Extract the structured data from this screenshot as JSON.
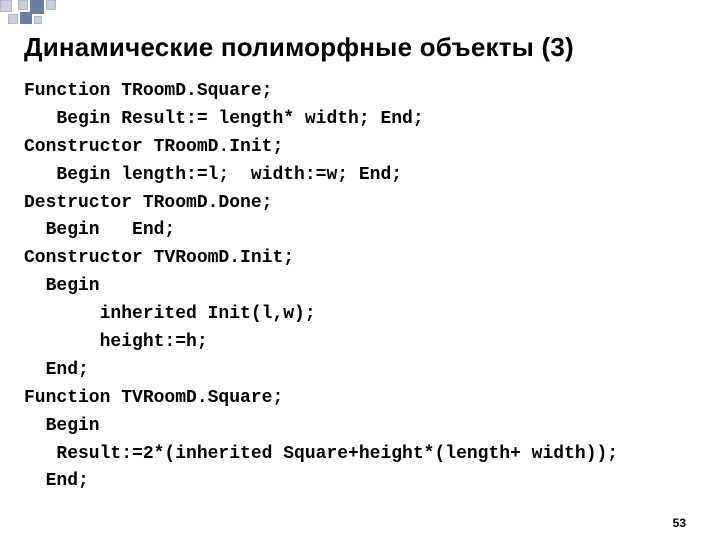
{
  "title": "Динамические полиморфные объекты (3)",
  "code_lines": [
    "Function TRoomD.Square;",
    "   Begin Result:= length* width; End;",
    "Constructor TRoomD.Init;",
    "   Begin length:=l;  width:=w; End;",
    "Destructor TRoomD.Done;",
    "  Begin   End;",
    "Constructor TVRoomD.Init;",
    "  Begin",
    "       inherited Init(l,w);",
    "       height:=h;",
    "  End;",
    "Function TVRoomD.Square;",
    "  Begin",
    "   Result:=2*(inherited Square+height*(length+ width));",
    "  End;"
  ],
  "page_number": "53"
}
